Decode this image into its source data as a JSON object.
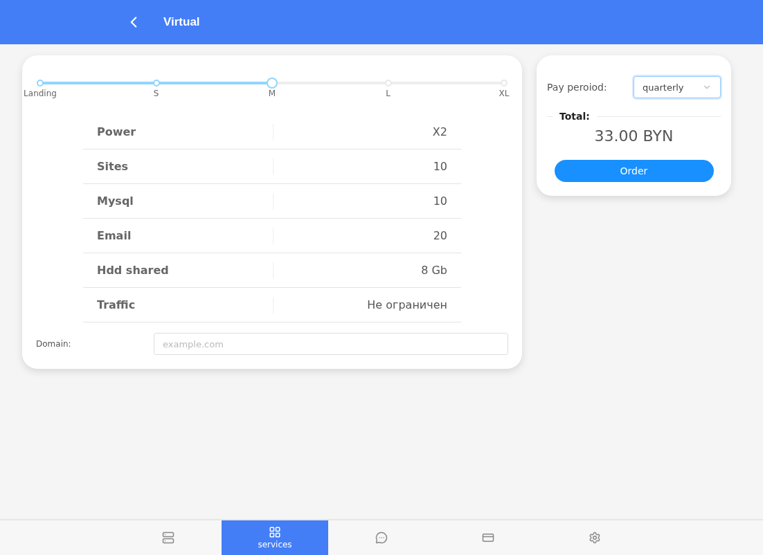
{
  "header": {
    "title": "Virtual"
  },
  "plan_slider": {
    "level": 0.5,
    "marks": [
      "Landing",
      "S",
      "M",
      "L",
      "XL"
    ]
  },
  "specs": [
    {
      "name": "Power",
      "value": "X2"
    },
    {
      "name": "Sites",
      "value": "10"
    },
    {
      "name": "Mysql",
      "value": "10"
    },
    {
      "name": "Email",
      "value": "20"
    },
    {
      "name": "Hdd shared",
      "value": "8 Gb"
    },
    {
      "name": "Traffic",
      "value": "Не ограничен"
    }
  ],
  "domain": {
    "label": "Domain:",
    "placeholder": "example.com"
  },
  "order": {
    "period_label": "Pay peroiod:",
    "period": "quarterly",
    "total_label": "Total:",
    "total": "33.00 BYN",
    "button": "Order"
  },
  "nav": [
    {
      "kind": "server",
      "selected": false
    },
    {
      "kind": "grid",
      "label": "services",
      "selected": true
    },
    {
      "kind": "chat",
      "selected": false
    },
    {
      "kind": "card",
      "selected": false
    },
    {
      "kind": "gear",
      "selected": false
    }
  ]
}
